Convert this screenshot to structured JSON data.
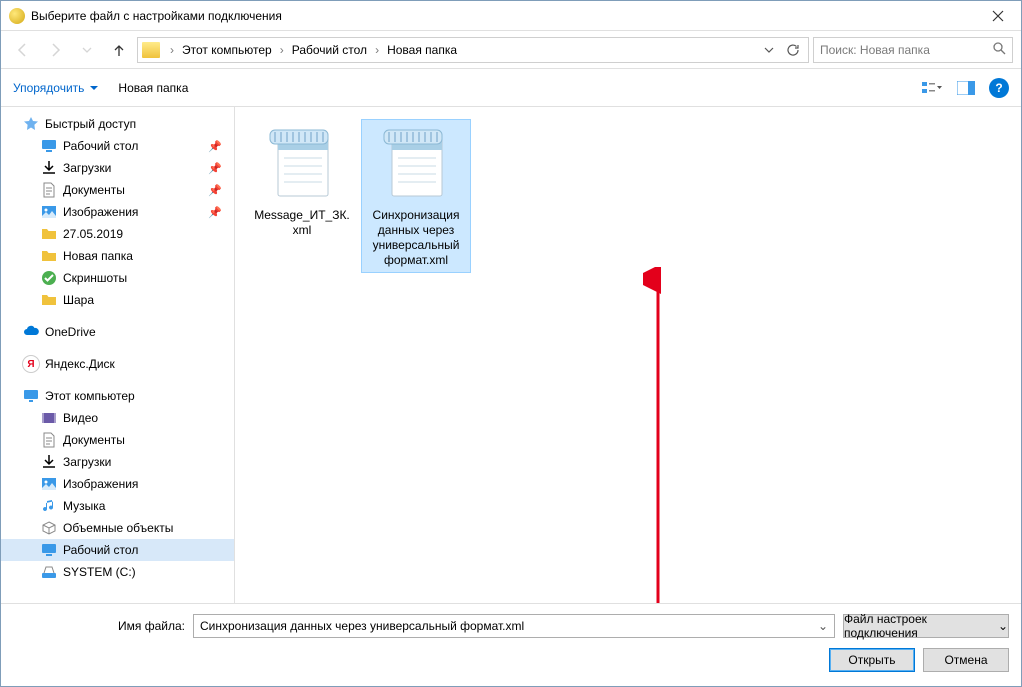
{
  "window": {
    "title": "Выберите файл с настройками подключения"
  },
  "breadcrumbs": [
    "Этот компьютер",
    "Рабочий стол",
    "Новая папка"
  ],
  "search": {
    "placeholder": "Поиск: Новая папка"
  },
  "toolbar": {
    "organize": "Упорядочить",
    "newfolder": "Новая папка"
  },
  "sidebar": [
    {
      "id": "quick",
      "label": "Быстрый доступ",
      "icon": "star",
      "group": true
    },
    {
      "id": "desktop1",
      "label": "Рабочий стол",
      "icon": "desktop",
      "child": true,
      "pin": true
    },
    {
      "id": "downloads1",
      "label": "Загрузки",
      "icon": "download",
      "child": true,
      "pin": true
    },
    {
      "id": "docs1",
      "label": "Документы",
      "icon": "docs",
      "child": true,
      "pin": true
    },
    {
      "id": "pics1",
      "label": "Изображения",
      "icon": "pics",
      "child": true,
      "pin": true
    },
    {
      "id": "date",
      "label": "27.05.2019",
      "icon": "folder",
      "child": true
    },
    {
      "id": "newf",
      "label": "Новая папка",
      "icon": "folder",
      "child": true
    },
    {
      "id": "shots",
      "label": "Скриншоты",
      "icon": "check",
      "child": true
    },
    {
      "id": "shara",
      "label": "Шара",
      "icon": "folder",
      "child": true
    },
    {
      "id": "sp1",
      "spacer": true
    },
    {
      "id": "onedrive",
      "label": "OneDrive",
      "icon": "cloud",
      "group": true
    },
    {
      "id": "sp2",
      "spacer": true
    },
    {
      "id": "yandex",
      "label": "Яндекс.Диск",
      "icon": "yandex",
      "group": true
    },
    {
      "id": "sp3",
      "spacer": true
    },
    {
      "id": "thispc",
      "label": "Этот компьютер",
      "icon": "pc",
      "group": true
    },
    {
      "id": "video",
      "label": "Видео",
      "icon": "video",
      "child": true
    },
    {
      "id": "docs2",
      "label": "Документы",
      "icon": "docs",
      "child": true
    },
    {
      "id": "downloads2",
      "label": "Загрузки",
      "icon": "download",
      "child": true
    },
    {
      "id": "pics2",
      "label": "Изображения",
      "icon": "pics",
      "child": true
    },
    {
      "id": "music",
      "label": "Музыка",
      "icon": "music",
      "child": true
    },
    {
      "id": "vol",
      "label": "Объемные объекты",
      "icon": "vol",
      "child": true
    },
    {
      "id": "desktop2",
      "label": "Рабочий стол",
      "icon": "desktop",
      "child": true,
      "selected": true
    },
    {
      "id": "sysc",
      "label": "SYSTEM (C:)",
      "icon": "drive",
      "child": true
    }
  ],
  "files": [
    {
      "name": "Message_ИТ_ЗК.xml",
      "selected": false
    },
    {
      "name": "Синхронизация данных через универсальный формат.xml",
      "selected": true
    }
  ],
  "footer": {
    "filename_label": "Имя файла:",
    "filename_value": "Синхронизация данных через универсальный формат.xml",
    "filetype": "Файл настроек подключения",
    "open": "Открыть",
    "cancel": "Отмена"
  }
}
